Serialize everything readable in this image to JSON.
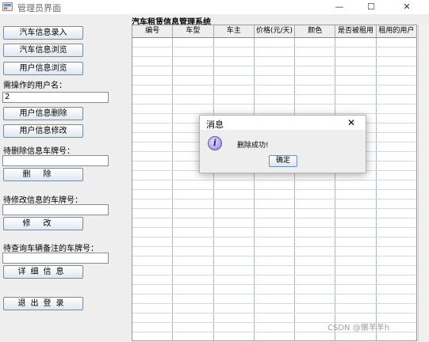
{
  "window": {
    "title": "管理员界面",
    "min_glyph": "—",
    "max_glyph": "☐",
    "close_glyph": "✕"
  },
  "sidebar": {
    "btn_add": "汽车信息录入",
    "btn_browse_car": "汽车信息浏览",
    "btn_browse_user": "用户信息浏览",
    "user_label": "需操作的用户名：",
    "user_value": "2",
    "btn_delete_user": "用户信息删除",
    "btn_edit_user": "用户信息修改",
    "delete_plate_label": "待删除信息车牌号：",
    "delete_plate_value": "",
    "btn_delete": "删除",
    "edit_plate_label": "待修改信息的车牌号：",
    "edit_plate_value": "",
    "btn_edit": "修改",
    "query_plate_label": "待查询车辆备注的车牌号：",
    "query_plate_value": "",
    "btn_detail": "详细信息",
    "btn_logout": "退出登录"
  },
  "table": {
    "title": "汽车租赁信息管理系统",
    "columns": [
      "编号",
      "车型",
      "车主",
      "价格(元/天)",
      "颜色",
      "是否被租用",
      "租用的用户"
    ],
    "rows": []
  },
  "dialog": {
    "title": "消息",
    "close_glyph": "✕",
    "icon_glyph": "i",
    "message": "删除成功!",
    "ok_label": "确定"
  },
  "watermark": "CSDN @懒羊羊h",
  "colors": {
    "panel": "#eeeeee",
    "button_border": "#7a8a99",
    "grid_line": "#aab7c6",
    "info_icon": "#8a84d6"
  }
}
